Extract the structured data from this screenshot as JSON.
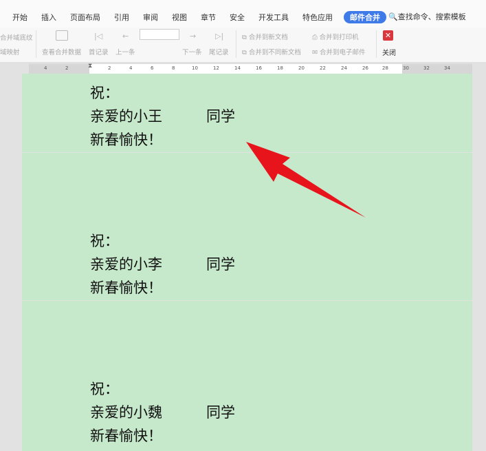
{
  "menu": {
    "items": [
      "开始",
      "插入",
      "页面布局",
      "引用",
      "审阅",
      "视图",
      "章节",
      "安全",
      "开发工具",
      "特色应用"
    ],
    "active_tab": "邮件合并",
    "search_label": "查找命令、搜索模板"
  },
  "ribbon": {
    "merge_field_label": "合并域底纹",
    "field_map_label": "域映射",
    "view_merged_data": "查看合并数据",
    "first_record": "首记录",
    "prev_record": "上一条",
    "next_record": "下一条",
    "last_record": "尾记录",
    "merge_new_doc": "合并到新文档",
    "merge_diff_docs": "合并到不同新文档",
    "merge_printer": "合并到打印机",
    "merge_email": "合并到电子邮件",
    "close_label": "关闭"
  },
  "ruler": {
    "ticks": [
      "4",
      "2",
      "2",
      "4",
      "6",
      "8",
      "10",
      "12",
      "14",
      "16",
      "18",
      "20",
      "22",
      "24",
      "26",
      "28",
      "30",
      "32",
      "34"
    ]
  },
  "letters": [
    {
      "greeting": "祝：",
      "recipient": "亲爱的小王",
      "title": "同学",
      "wish": "新春愉快！"
    },
    {
      "greeting": "祝：",
      "recipient": "亲爱的小李",
      "title": "同学",
      "wish": "新春愉快！"
    },
    {
      "greeting": "祝：",
      "recipient": "亲爱的小魏",
      "title": "同学",
      "wish": "新春愉快！"
    }
  ],
  "colors": {
    "page_bg": "#c6e9cb",
    "accent": "#3f7be8",
    "arrow": "#e8141b",
    "close": "#d9363e"
  }
}
